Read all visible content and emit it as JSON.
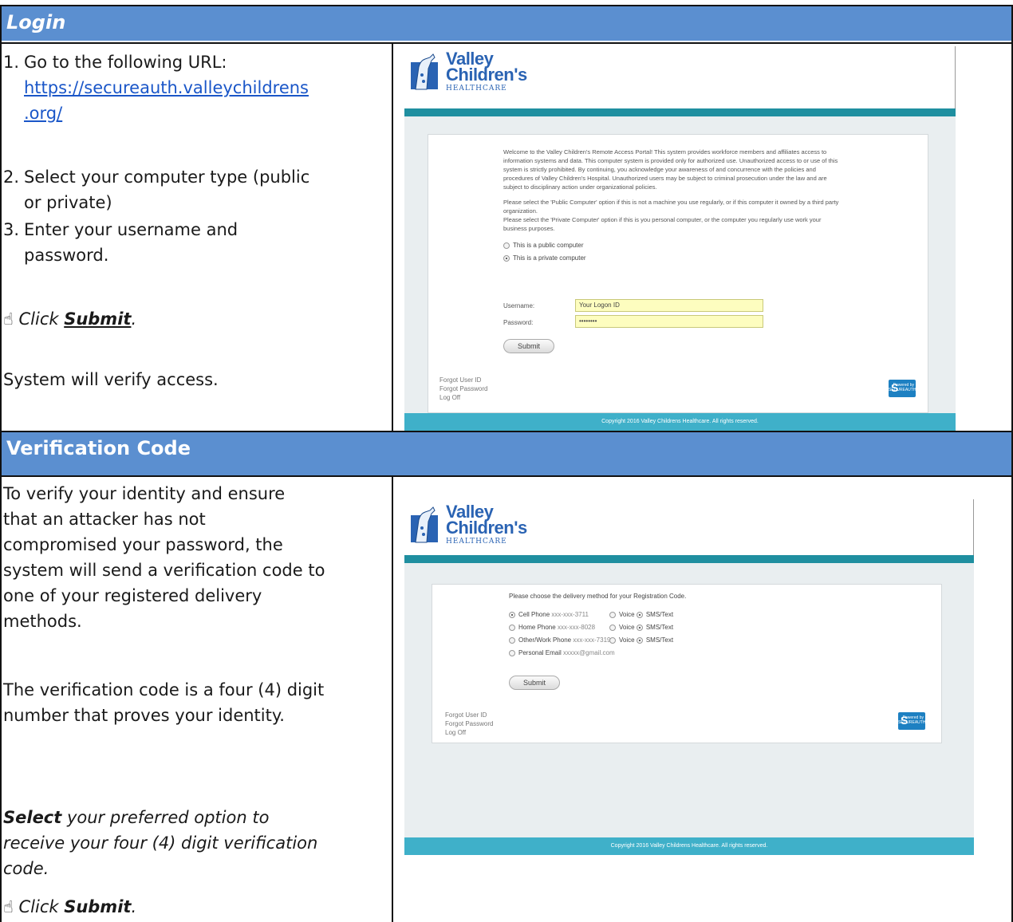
{
  "login": {
    "header": "Login",
    "step1_num": "1.",
    "step1_text": "Go to the following URL:",
    "url_line1": "https://secureauth.valleychildrens",
    "url_line2": ".org/",
    "step2_num": "2.",
    "step2_line1": "Select your computer type (public",
    "step2_line2": "or private)",
    "step3_num": "3.",
    "step3_line1": "Enter your username and",
    "step3_line2": "password.",
    "click_prefix": "Click ",
    "click_target": "Submit",
    "click_suffix": ".",
    "verify": "System will verify access."
  },
  "verification": {
    "header": "Verification Code",
    "para1_lines": [
      "To verify your identity and ensure",
      "that an attacker has not",
      "compromised your password, the",
      "system will send a verification code to",
      "one of your registered delivery",
      "methods."
    ],
    "para2_lines": [
      "The verification code is a four (4) digit",
      "number that proves your identity."
    ],
    "select_bold": "Select",
    "select_line1_rest": " your preferred option to",
    "select_line2": "receive your four (4) digit verification",
    "select_line3": "code.",
    "click_prefix": "Click ",
    "click_target": "Submit",
    "click_suffix": "."
  },
  "shot1": {
    "logo_line1": "Valley",
    "logo_line2": "Children's",
    "logo_sub": "HEALTHCARE",
    "welcome_lines": [
      "Welcome to the Valley Children's Remote Access Portal! This system provides workforce members and affiliates access to",
      "information systems and data. This computer system is provided only for authorized use. Unauthorized access to or use of this",
      "system is strictly prohibited. By continuing, you acknowledge your awareness of and concurrence with the policies and",
      "procedures of Valley Children's Hospital. Unauthorized users may be subject to criminal prosecution under the law and are",
      "subject to disciplinary action under organizational policies."
    ],
    "select_lines": [
      "Please select the 'Public Computer' option if this is not a machine you use regularly, or if this computer it owned by a third party",
      "organization.",
      "Please select the 'Private Computer' option if this is you personal computer, or the computer you regularly use work your",
      "business purposes."
    ],
    "public_option": "This is a public computer",
    "private_option": "This is a private computer",
    "username_label": "Username:",
    "username_value": "Your Logon ID",
    "password_label": "Password:",
    "password_value": "••••••••",
    "submit": "Submit",
    "forgot_user": "Forgot User ID",
    "forgot_password": "Forgot Password",
    "log_off": "Log Off",
    "badge_top": "Powered by",
    "badge_bottom": "SECUREAUTH",
    "footer": "Copyright 2016 Valley Childrens Healthcare. All rights reserved."
  },
  "shot2": {
    "logo_line1": "Valley",
    "logo_line2": "Children's",
    "logo_sub": "HEALTHCARE",
    "prompt": "Please choose the delivery method for your Registration Code.",
    "options": [
      {
        "label": "Cell Phone",
        "masked": "xxx-xxx-3711",
        "voice": "Voice",
        "sms": "SMS/Text"
      },
      {
        "label": "Home Phone",
        "masked": "xxx-xxx-8028",
        "voice": "Voice",
        "sms": "SMS/Text"
      },
      {
        "label": "Other/Work Phone",
        "masked": "xxx-xxx-7319",
        "voice": "Voice",
        "sms": "SMS/Text"
      },
      {
        "label": "Personal Email",
        "masked": "xxxxx@gmail.com"
      }
    ],
    "submit": "Submit",
    "forgot_user": "Forgot User ID",
    "forgot_password": "Forgot Password",
    "log_off": "Log Off",
    "badge_top": "Powered by",
    "badge_bottom": "SECUREAUTH",
    "footer": "Copyright 2016 Valley Childrens Healthcare. All rights reserved."
  }
}
